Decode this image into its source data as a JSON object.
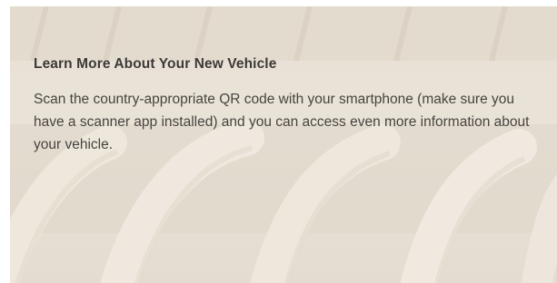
{
  "heading": "Learn More About Your New Vehicle",
  "body": "Scan the country-appropriate QR code with your smartphone (make sure you have a scanner app installed) and you can access even more information about your vehicle.",
  "colors": {
    "background": "#e6ddd0",
    "heading_text": "#3c3a37",
    "body_text": "#47443f"
  }
}
